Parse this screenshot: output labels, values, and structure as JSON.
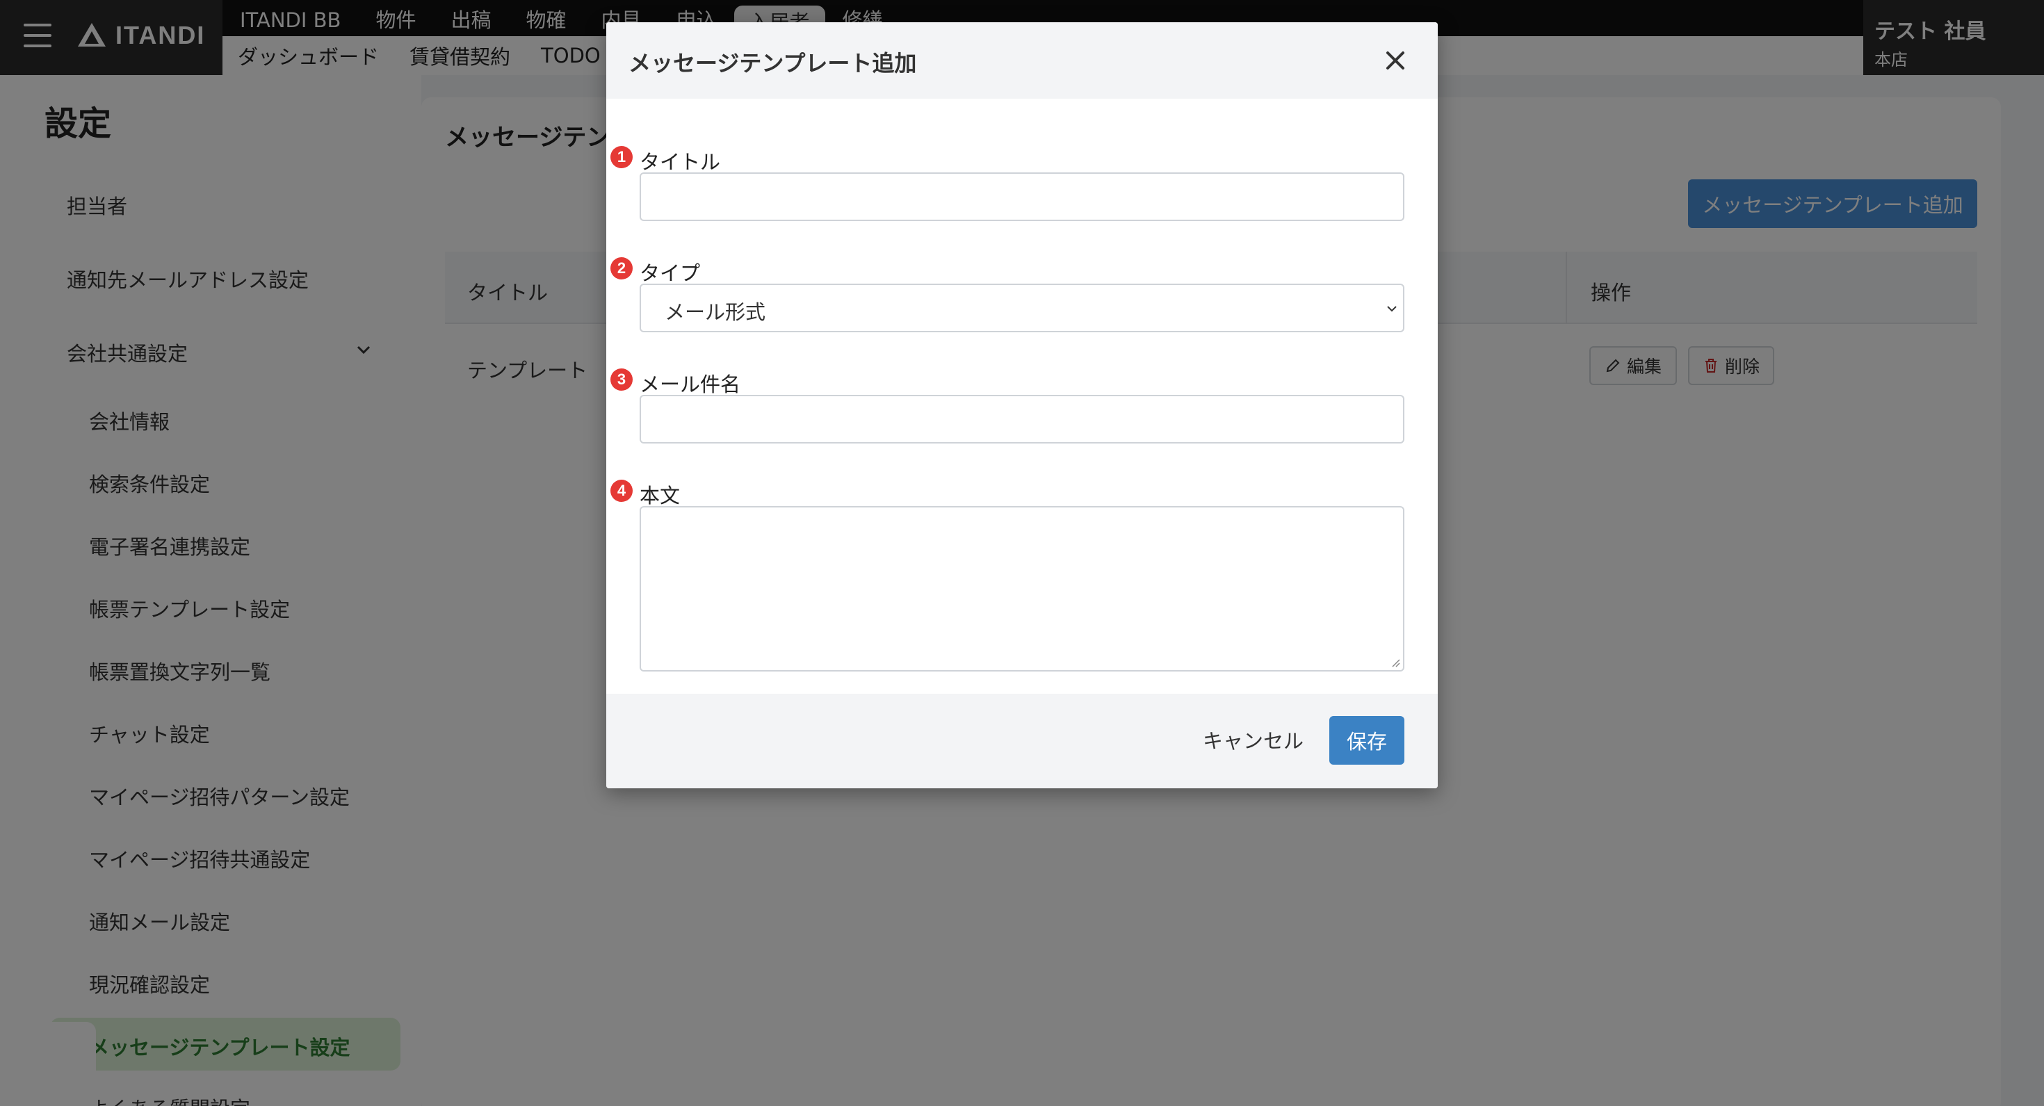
{
  "header": {
    "logo_text": "ITANDI",
    "nav_top": [
      "ITANDI BB",
      "物件",
      "出稿",
      "物確",
      "内見",
      "申込",
      "入居者",
      "修繕"
    ],
    "nav_top_active_index": 6,
    "nav_sub": [
      "ダッシュボード",
      "賃貸借契約",
      "TODO"
    ],
    "user_name": "テスト 社員",
    "user_branch": "本店"
  },
  "sidebar": {
    "title": "設定",
    "items": [
      "担当者",
      "通知先メールアドレス設定",
      "会社共通設定"
    ],
    "sub_items": [
      "会社情報",
      "検索条件設定",
      "電子署名連携設定",
      "帳票テンプレート設定",
      "帳票置換文字列一覧",
      "チャット設定",
      "マイページ招待パターン設定",
      "マイページ招待共通設定",
      "通知メール設定",
      "現況確認設定",
      "メッセージテンプレート設定",
      "よくある質問設定"
    ],
    "active_item": "メッセージテンプレート設定"
  },
  "main": {
    "title": "メッセージテンプレート設定",
    "add_button": "メッセージテンプレート追加",
    "columns": [
      "タイトル",
      "操作"
    ],
    "rows": [
      {
        "title": "テンプレート",
        "edit": "編集",
        "delete": "削除"
      }
    ]
  },
  "modal": {
    "title": "メッセージテンプレート追加",
    "fields": {
      "title": {
        "marker": "1",
        "label": "タイトル",
        "value": ""
      },
      "type": {
        "marker": "2",
        "label": "タイプ",
        "value": "メール形式"
      },
      "subject": {
        "marker": "3",
        "label": "メール件名",
        "value": ""
      },
      "body": {
        "marker": "4",
        "label": "本文",
        "value": ""
      }
    },
    "cancel_label": "キャンセル",
    "save_label": "保存"
  },
  "colors": {
    "topbar": "#111111",
    "primary": "#3b82c4",
    "active_sidebar_bg": "#dcf0d6",
    "active_sidebar_text": "#2e7d32",
    "marker": "#e53935"
  }
}
